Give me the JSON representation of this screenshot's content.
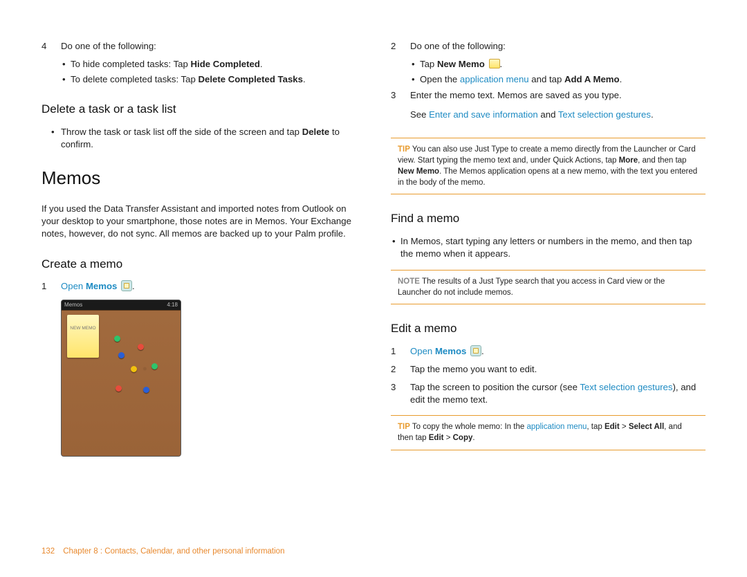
{
  "left": {
    "step4_num": "4",
    "step4_text": "Do one of the following:",
    "step4_b1_prefix": "To hide completed tasks: Tap ",
    "step4_b1_bold": "Hide Completed",
    "step4_b1_suffix": ".",
    "step4_b2_prefix": "To delete completed tasks: Tap ",
    "step4_b2_bold": "Delete Completed Tasks",
    "step4_b2_suffix": ".",
    "h_delete": "Delete a task or a task list",
    "delete_bullet_pre": "Throw the task or task list off the side of the screen and tap ",
    "delete_bullet_bold": "Delete",
    "delete_bullet_post": " to confirm.",
    "h_memos": "Memos",
    "memos_para": "If you used the Data Transfer Assistant and imported notes from Outlook on your desktop to your smartphone, those notes are in Memos. Your Exchange notes, however, do not sync. All memos are backed up to your Palm profile.",
    "h_create": "Create a memo",
    "create_s1_num": "1",
    "create_s1_link": "Open ",
    "create_s1_bold": "Memos",
    "create_s1_dot": ".",
    "shot_title": "Memos",
    "shot_time": "4:18",
    "shot_note": "NEW\nMEMO"
  },
  "right": {
    "step2_num": "2",
    "step2_text": "Do one of the following:",
    "step2_b1_pre": "Tap ",
    "step2_b1_bold": "New Memo",
    "step2_b1_post": ".",
    "step2_b2_pre": "Open the ",
    "step2_b2_link": "application menu",
    "step2_b2_mid": " and tap ",
    "step2_b2_bold": "Add A Memo",
    "step2_b2_post": ".",
    "step3_num": "3",
    "step3_text": "Enter the memo text. Memos are saved as you type.",
    "see_pre": "See ",
    "see_l1": "Enter and save information",
    "see_and": " and ",
    "see_l2": "Text selection gestures",
    "see_post": ".",
    "tip1_lead": "TIP",
    "tip1_a": " You can also use Just Type to create a memo directly from the Launcher or Card view. Start typing the memo text and, under Quick Actions, tap ",
    "tip1_b1": "More",
    "tip1_b": ", and then tap ",
    "tip1_b2": "New Memo",
    "tip1_c": ". The Memos application opens at a new memo, with the text you entered in the body of the memo.",
    "h_find": "Find a memo",
    "find_bullet": "In Memos, start typing any letters or numbers in the memo, and then tap the memo when it appears.",
    "note_lead": "NOTE",
    "note_text": " The results of a Just Type search that you access in Card view or the Launcher do not include memos.",
    "h_edit": "Edit a memo",
    "edit_s1_num": "1",
    "edit_s1_link": "Open ",
    "edit_s1_bold": "Memos",
    "edit_s1_dot": ".",
    "edit_s2_num": "2",
    "edit_s2_text": "Tap the memo you want to edit.",
    "edit_s3_num": "3",
    "edit_s3_pre": "Tap the screen to position the cursor (see ",
    "edit_s3_link": "Text selection gestures",
    "edit_s3_post": "), and edit the memo text.",
    "tip2_lead": "TIP",
    "tip2_a": " To copy the whole memo: In the ",
    "tip2_link": "application menu",
    "tip2_b": ", tap ",
    "tip2_b1": "Edit",
    "tip2_gt1": " > ",
    "tip2_b2": "Select All",
    "tip2_c": ", and then tap ",
    "tip2_b3": "Edit",
    "tip2_gt2": " > ",
    "tip2_b4": "Copy",
    "tip2_d": "."
  },
  "footer": {
    "page": "132",
    "chapter": "Chapter 8 : Contacts, Calendar, and other personal information"
  }
}
